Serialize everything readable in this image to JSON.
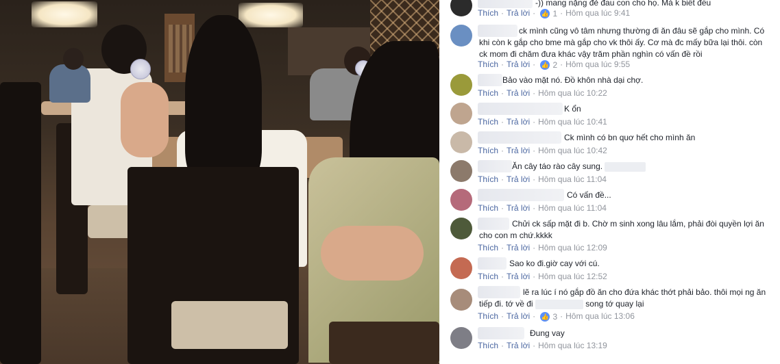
{
  "comments": [
    {
      "text": "-)) mang nặng đẻ đau con cho họ. Mà k biết đều",
      "like": "Thích",
      "reply": "Trả lời",
      "likes": "1",
      "time": "Hôm qua lúc 9:41",
      "avatar_color": "#2b2b2b"
    },
    {
      "text": "ck mình cũng vô tâm nhưng thường đi ăn đâu sẽ gắp cho mình. Có khi còn k gắp cho bme mà gắp cho vk thôi ấy. Cơ mà đc mấy bữa lại thôi. còn ck mom đi chăm đưa khác vậy trăm phần nghìn có vấn đề rồi",
      "like": "Thích",
      "reply": "Trả lời",
      "likes": "2",
      "time": "Hôm qua lúc 9:55",
      "avatar_color": "#6a8fc2"
    },
    {
      "text": "Bảo vào mặt nó. Đồ khôn nhà dại chợ.",
      "like": "Thích",
      "reply": "Trả lời",
      "time": "Hôm qua lúc 10:22",
      "avatar_color": "#9a9a3a"
    },
    {
      "text": "K ổn",
      "like": "Thích",
      "reply": "Trả lời",
      "time": "Hôm qua lúc 10:41",
      "avatar_color": "#bfa58f"
    },
    {
      "text": "Ck mình có bn quơ hết cho mình ăn",
      "like": "Thích",
      "reply": "Trả lời",
      "time": "Hôm qua lúc 10:42",
      "avatar_color": "#c9b9a8"
    },
    {
      "text": "Ăn cây táo rào cây sung.",
      "like": "Thích",
      "reply": "Trả lời",
      "time": "Hôm qua lúc 11:04",
      "avatar_color": "#8c7a6b"
    },
    {
      "text": "Có vấn đề...",
      "like": "Thích",
      "reply": "Trả lời",
      "time": "Hôm qua lúc 11:04",
      "avatar_color": "#b56a7a"
    },
    {
      "text": "Chửi ck sấp mặt đi b. Chờ m sinh xong lâu lắm, phải đòi quyền lợi ăn cho con m chứ.kkkk",
      "like": "Thích",
      "reply": "Trả lời",
      "time": "Hôm qua lúc 12:09",
      "avatar_color": "#4e5a3a"
    },
    {
      "text": "Sao ko đi.giờ cay với cú.",
      "like": "Thích",
      "reply": "Trả lời",
      "time": "Hôm qua lúc 12:52",
      "avatar_color": "#c46a52"
    },
    {
      "text_a": "lẽ ra lúc í nó gắp đồ ăn cho đứa khác thớt phải bảo. thôi mọi ng ăn tiếp đi. tớ về đi",
      "text_b": "song tớ quay lại",
      "like": "Thích",
      "reply": "Trả lời",
      "likes": "3",
      "time": "Hôm qua lúc 13:06",
      "avatar_color": "#a78c7a"
    },
    {
      "text": "Đung vay",
      "like": "Thích",
      "reply": "Trả lời",
      "time": "Hôm qua lúc 13:19",
      "avatar_color": "#7e7e86"
    }
  ],
  "icons": {
    "like": "thumbs-up-icon"
  }
}
